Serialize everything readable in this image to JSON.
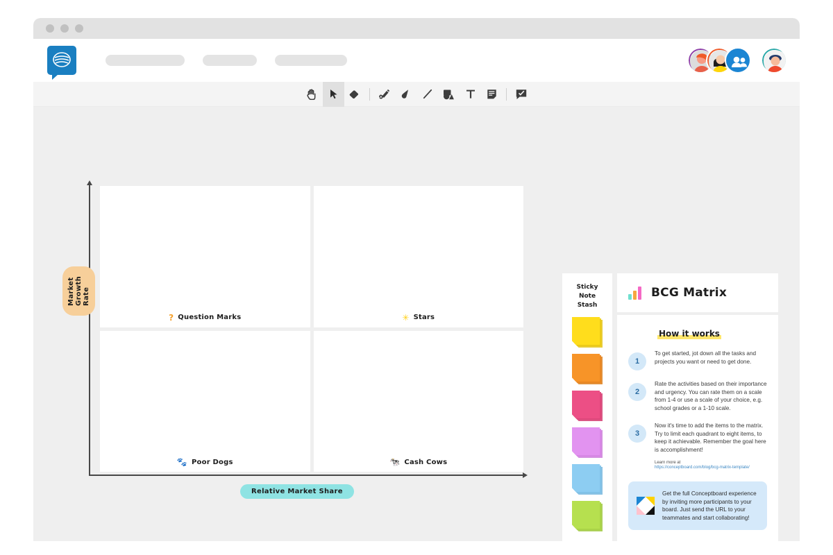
{
  "window": {
    "traffic_lights": [
      "close",
      "minimize",
      "maximize"
    ]
  },
  "header": {
    "logo_name": "conceptboard-logo",
    "nav_placeholders": [
      "",
      "",
      ""
    ],
    "avatars": [
      {
        "name": "participant-avatar-1",
        "ring": "#8e3fa8"
      },
      {
        "name": "participant-avatar-2",
        "ring": "#f05a28"
      },
      {
        "name": "participants-more",
        "ring": "#1b85d3"
      },
      {
        "name": "current-user-avatar",
        "ring": "#2aa8a8"
      }
    ]
  },
  "toolbar": {
    "tools": [
      {
        "name": "hand-tool",
        "icon": "✋",
        "active": false
      },
      {
        "name": "select-tool",
        "icon": "➤",
        "active": true
      },
      {
        "name": "eraser-tool",
        "icon": "◗",
        "active": false
      },
      {
        "name": "pen-tool",
        "icon": "✎",
        "active": false
      },
      {
        "name": "highlighter-tool",
        "icon": "🖋",
        "active": false
      },
      {
        "name": "line-tool",
        "icon": "／",
        "active": false
      },
      {
        "name": "shapes-tool",
        "icon": "◣",
        "active": false
      },
      {
        "name": "text-tool",
        "icon": "T",
        "active": false
      },
      {
        "name": "sticky-note-tool",
        "icon": "▤",
        "active": false
      },
      {
        "name": "comment-tool",
        "icon": "💬",
        "active": false
      }
    ]
  },
  "chart_data": {
    "type": "table",
    "title": "BCG Matrix",
    "xlabel": "Relative Market Share",
    "ylabel": "Market Growth Rate",
    "quadrants": [
      {
        "label": "Question Marks",
        "icon": "?",
        "icon_color": "#f5a02b",
        "row": "high-growth",
        "col": "low-share",
        "items": []
      },
      {
        "label": "Stars",
        "icon": "✳",
        "icon_color": "#ffd11a",
        "row": "high-growth",
        "col": "high-share",
        "items": []
      },
      {
        "label": "Poor Dogs",
        "icon": "🐾",
        "icon_color": "#8d6e52",
        "row": "low-growth",
        "col": "low-share",
        "items": []
      },
      {
        "label": "Cash Cows",
        "icon": "🐄",
        "icon_color": "#9a9ad6",
        "row": "low-growth",
        "col": "high-share",
        "items": []
      }
    ],
    "axis_label_colors": {
      "y": "#f7cf9a",
      "x": "#8fe3e3"
    },
    "grid": false,
    "legend": "none"
  },
  "stash": {
    "title_lines": [
      "Sticky",
      "Note",
      "Stash"
    ],
    "colors": [
      {
        "name": "yellow",
        "top": "#ffdd1c",
        "shade": "#e5c313"
      },
      {
        "name": "orange",
        "top": "#f79428",
        "shade": "#dd7c17"
      },
      {
        "name": "pink",
        "top": "#ec4f85",
        "shade": "#d33a70"
      },
      {
        "name": "violet",
        "top": "#e293f0",
        "shade": "#cc7bdb"
      },
      {
        "name": "blue",
        "top": "#8dcdf2",
        "shade": "#74b6de"
      },
      {
        "name": "green",
        "top": "#b6e04f",
        "shade": "#9dc83b"
      }
    ]
  },
  "info_panel": {
    "title": "BCG Matrix",
    "chart_icon_bars": [
      "#6fe0cf",
      "#f7a541",
      "#f569c5"
    ],
    "section_heading": "How it works",
    "steps": [
      {
        "number": "1",
        "text": "To get started, jot down all the tasks and projects you want or need to get done."
      },
      {
        "number": "2",
        "text": "Rate the activities based on their importance and urgency. You can rate them on a scale from 1-4 or use a scale of your choice, e.g. school grades or a 1-10 scale."
      },
      {
        "number": "3",
        "text": "Now it's time to add the items to the matrix. Try to limit each quadrant to eight items, to keep it achievable. Remember the goal here is accomplishment!"
      }
    ],
    "learn_more_label": "Learn more at",
    "learn_more_url": "https://conceptboard.com/blog/bcg-matrix-template/",
    "callout": {
      "icon_name": "conceptboard-square-icon",
      "text": "Get the full Conceptboard experience by inviting more participants to your board. Just send the URL to your teammates and start collaborating!",
      "background": "#d5e9fa"
    }
  }
}
